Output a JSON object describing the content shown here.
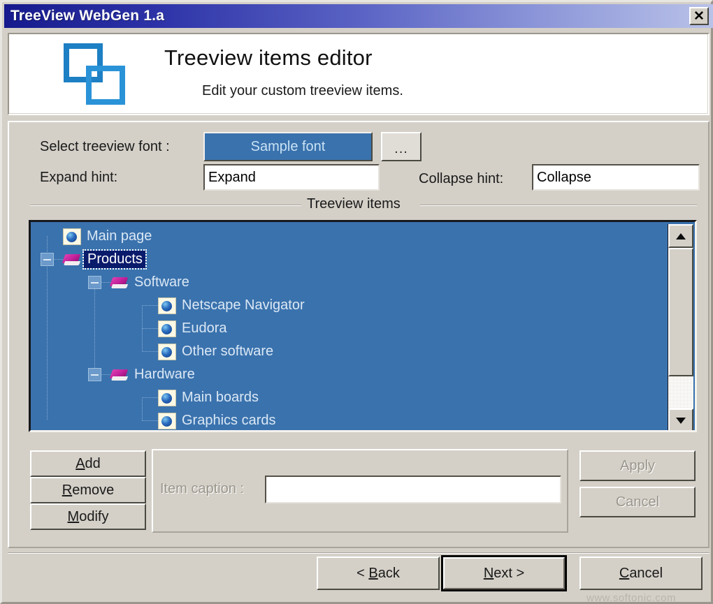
{
  "window": {
    "title": "TreeView WebGen 1.a",
    "close_label": "✕",
    "titlebar_gradient_start": "#161a8c",
    "titlebar_gradient_end": "#b9c2e8",
    "background": "#d4d0c8"
  },
  "header": {
    "icon": "two-overlapping-squares-icon",
    "title": "Treeview items editor",
    "subtitle": "Edit your custom treeview items."
  },
  "form": {
    "font_label": "Select treeview font :",
    "font_button_label": "Sample font",
    "font_button_bg": "#3a72ad",
    "font_button_fg": "#c9e2f5",
    "browse_button_label": "...",
    "expand_label": "Expand hint:",
    "expand_value": "Expand",
    "expand_placeholder": "Expand",
    "collapse_label": "Collapse hint:",
    "collapse_value": "Collapse",
    "collapse_placeholder": "Collapse"
  },
  "group": {
    "label": "Treeview items"
  },
  "tree": {
    "background": "#3a72ad",
    "text_color": "#dbe8f5",
    "selection_bg": "#0b1b6b",
    "selection_fg": "#ffffff",
    "items": [
      {
        "label": "Main page",
        "depth": 1,
        "icon": "page-globe-icon",
        "expander": "none",
        "selected": false
      },
      {
        "label": "Products",
        "depth": 1,
        "icon": "book-icon",
        "expander": "minus",
        "selected": true
      },
      {
        "label": "Software",
        "depth": 2,
        "icon": "book-icon",
        "expander": "minus",
        "selected": false
      },
      {
        "label": "Netscape Navigator",
        "depth": 3,
        "icon": "page-globe-icon",
        "expander": "none",
        "selected": false
      },
      {
        "label": "Eudora",
        "depth": 3,
        "icon": "page-globe-icon",
        "expander": "none",
        "selected": false
      },
      {
        "label": "Other software",
        "depth": 3,
        "icon": "page-globe-icon",
        "expander": "none",
        "selected": false
      },
      {
        "label": "Hardware",
        "depth": 2,
        "icon": "book-icon",
        "expander": "minus",
        "selected": false
      },
      {
        "label": "Main boards",
        "depth": 3,
        "icon": "page-globe-icon",
        "expander": "none",
        "selected": false
      },
      {
        "label": "Graphics cards",
        "depth": 3,
        "icon": "page-globe-icon",
        "expander": "none",
        "selected": false
      }
    ]
  },
  "scrollbar": {
    "up_arrow": "scroll-up-icon",
    "down_arrow": "scroll-down-icon"
  },
  "actions": {
    "add": {
      "prefix": "",
      "accel": "A",
      "suffix": "dd",
      "disabled": false
    },
    "remove": {
      "prefix": "",
      "accel": "R",
      "suffix": "emove",
      "disabled": false
    },
    "modify": {
      "prefix": "",
      "accel": "M",
      "suffix": "odify",
      "disabled": false
    },
    "apply_label": "Apply",
    "apply_disabled": true,
    "cancel_label": "Cancel",
    "cancel_disabled": true
  },
  "caption": {
    "label": "Item caption :",
    "value": "",
    "placeholder": "",
    "disabled": true
  },
  "footer": {
    "back": {
      "prefix": "< ",
      "accel": "B",
      "suffix": "ack"
    },
    "next": {
      "prefix": "",
      "accel": "N",
      "suffix": "ext >"
    },
    "cancel": {
      "prefix": "",
      "accel": "C",
      "suffix": "ancel"
    }
  },
  "watermark": {
    "text": "www.softonic.com"
  }
}
